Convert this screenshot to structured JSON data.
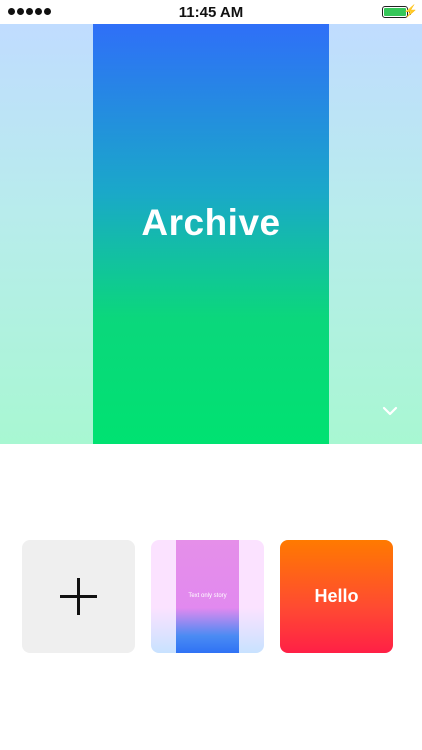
{
  "status_bar": {
    "time": "11:45 AM"
  },
  "hero": {
    "title": "Archive",
    "chevron_icon": "chevron-down-icon"
  },
  "cards": [
    {
      "type": "add",
      "icon": "plus-icon"
    },
    {
      "type": "story",
      "label": "Text only story"
    },
    {
      "type": "story",
      "label": "Hello"
    }
  ],
  "colors": {
    "hero_center_top": "#2f6ff8",
    "hero_center_bottom": "#00e271",
    "hello_top": "#ff7a00",
    "hello_bottom": "#ff2046"
  }
}
